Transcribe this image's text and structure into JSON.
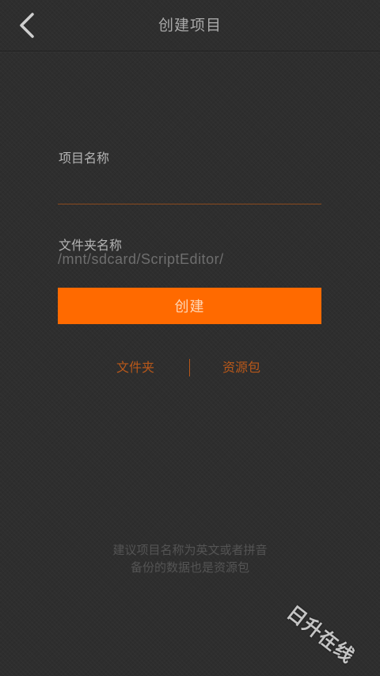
{
  "header": {
    "title": "创建项目",
    "back_icon": "chevron-left-icon"
  },
  "form": {
    "project_name_label": "项目名称",
    "project_name_value": "",
    "folder_name_label": "文件夹名称",
    "folder_path": "/mnt/sdcard/ScriptEditor/",
    "create_label": "创建"
  },
  "links": {
    "folder": "文件夹",
    "resource_pack": "资源包"
  },
  "hints": {
    "line1": "建议项目名称为英文或者拼音",
    "line2": "备份的数据也是资源包"
  },
  "watermark": "日升在线",
  "colors": {
    "accent": "#ff6a00",
    "link": "#b8581a",
    "background": "#2e2e2e"
  }
}
